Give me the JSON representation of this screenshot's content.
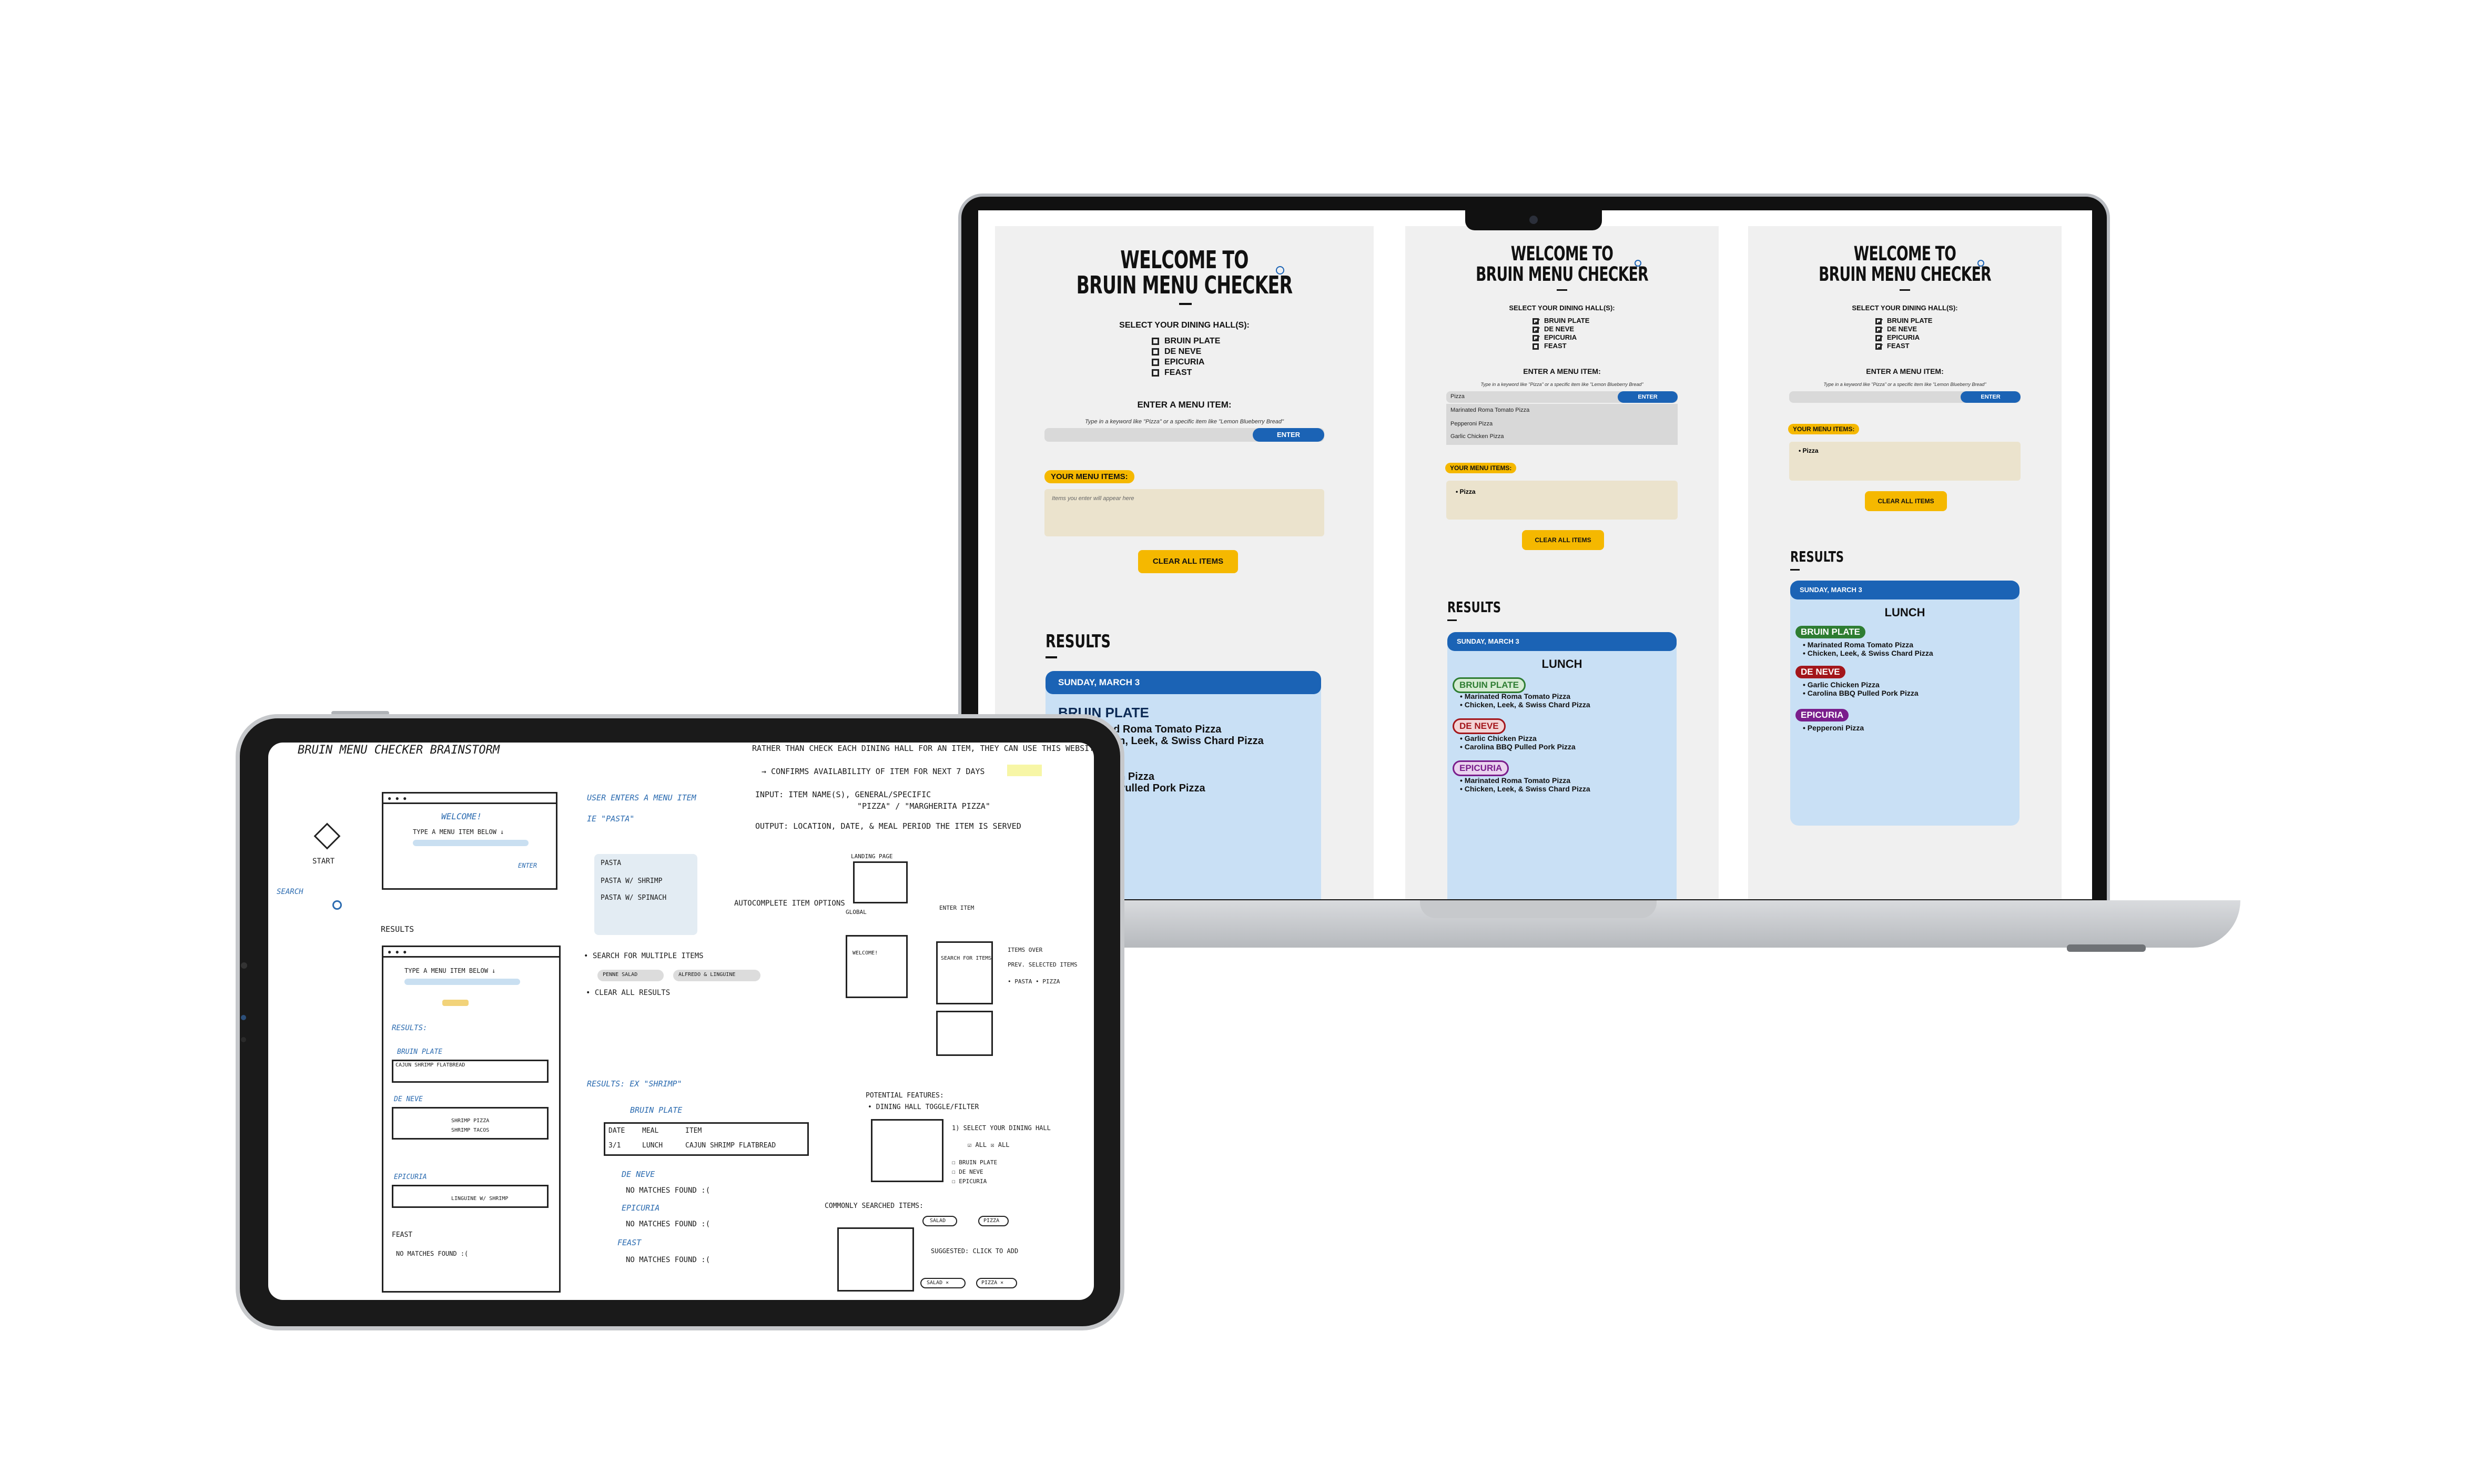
{
  "app": {
    "title_line1": "WELCOME TO",
    "title_line2": "BRUIN MENU CHECKER",
    "info_icon": "info-circle-icon",
    "select_label": "SELECT YOUR DINING HALL(S):",
    "halls": [
      "BRUIN PLATE",
      "DE NEVE",
      "EPICURIA",
      "FEAST"
    ],
    "enter_label": "ENTER A MENU ITEM:",
    "hint": "Type in a keyword like \"Pizza\" or a specific item like \"Lemon Blueberry Bread\"",
    "enter_button": "ENTER",
    "your_items_label": "YOUR MENU ITEMS:",
    "items_placeholder": "Items you enter will appear here",
    "clear_button": "CLEAR ALL ITEMS",
    "results_label": "RESULTS",
    "date": "SUNDAY, MARCH 3",
    "meal": "LUNCH",
    "colors": {
      "accent_blue": "#1b63b5",
      "yellow": "#f5b800",
      "result_bg": "#c9e0f5",
      "bruin_plate": "#2e7d32",
      "de_neve": "#a3161b",
      "epicuria": "#7a1e8c"
    }
  },
  "panel1": {
    "checked": [
      false,
      false,
      false,
      false
    ],
    "results_hall": "BRUIN PLATE",
    "results_items_visible": [
      "…nated Roma Tomato Pizza",
      "…hicken, Leek, & Swiss Chard Pizza",
      "…hicken Pizza",
      "…BBQ Pulled Pork Pizza"
    ]
  },
  "panel2": {
    "checked": [
      true,
      true,
      true,
      false
    ],
    "input_value": "Pizza",
    "dropdown": [
      "Marinated Roma Tomato Pizza",
      "Pepperoni Pizza",
      "Garlic Chicken Pizza"
    ],
    "your_items": [
      "Pizza"
    ],
    "results": [
      {
        "hall": "BRUIN PLATE",
        "items": [
          "Marinated Roma Tomato Pizza",
          "Chicken, Leek, & Swiss Chard Pizza"
        ]
      },
      {
        "hall": "DE NEVE",
        "items": [
          "Garlic Chicken Pizza",
          "Carolina BBQ Pulled Pork Pizza"
        ]
      },
      {
        "hall": "EPICURIA",
        "items": [
          "Marinated Roma Tomato Pizza",
          "Chicken, Leek, & Swiss Chard Pizza"
        ]
      }
    ]
  },
  "panel3": {
    "checked": [
      true,
      true,
      true,
      true
    ],
    "your_items": [
      "Pizza"
    ],
    "results": [
      {
        "hall": "BRUIN PLATE",
        "items": [
          "Marinated Roma Tomato Pizza",
          "Chicken, Leek, & Swiss Chard Pizza"
        ]
      },
      {
        "hall": "DE NEVE",
        "items": [
          "Garlic Chicken Pizza",
          "Carolina BBQ Pulled Pork Pizza"
        ]
      },
      {
        "hall": "EPICURIA",
        "items": [
          "Pepperoni Pizza"
        ]
      }
    ]
  },
  "sketch": {
    "heading": "BRUIN MENU CHECKER BRAINSTORM",
    "intro": "RATHER THAN CHECK EACH DINING HALL FOR AN ITEM, THEY CAN USE THIS WEBSITE TO SEARCH FOR THE ITEM",
    "intro2": "→ CONFIRMS AVAILABILITY OF ITEM FOR NEXT 7 DAYS",
    "input_line": "INPUT: ITEM NAME(S), GENERAL/SPECIFIC",
    "input_ex": "\"PIZZA\" / \"MARGHERITA PIZZA\"",
    "output_line": "OUTPUT: LOCATION, DATE, & MEAL PERIOD THE ITEM IS SERVED",
    "start": "START",
    "search": "SEARCH",
    "welcome": "WELCOME!",
    "type_item": "TYPE A MENU ITEM BELOW ↓",
    "enter": "ENTER",
    "user_enters": "USER ENTERS A MENU ITEM",
    "user_enters2": "IE \"PASTA\"",
    "dd": [
      "PASTA",
      "PASTA W/ SHRIMP",
      "PASTA W/ SPINACH"
    ],
    "autocomplete": "AUTOCOMPLETE ITEM OPTIONS",
    "results": "RESULTS",
    "multi": "• SEARCH FOR MULTIPLE ITEMS",
    "tags": [
      "PENNE SALAD",
      "ALFREDO & LINGUINE"
    ],
    "clear": "• CLEAR ALL RESULTS",
    "r_results": "RESULTS:",
    "bp": "BRUIN PLATE",
    "dn": "DE NEVE",
    "ep": "EPICURIA",
    "feast": "FEAST",
    "nomatch": "NO MATCHES FOUND :(",
    "tbl_head": [
      "DATE",
      "MEAL",
      "ITEM"
    ],
    "row_bp": [
      "3/1",
      "LUNCH",
      "CAJUN SHRIMP FLATBREAD"
    ],
    "row_dn1": [
      "3/1",
      "LUNCH",
      "SHRIMP PIZZA"
    ],
    "row_dn2": [
      "3/1",
      "LUNCH",
      "SHRIMP TACOS"
    ],
    "row_ep": [
      "3/1",
      "LUNCH",
      "LINGUINE W/ SHRIMP"
    ],
    "results_ex": "RESULTS: EX \"SHRIMP\"",
    "landing": "LANDING PAGE",
    "global": "GLOBAL",
    "enter_item": "ENTER ITEM",
    "search_for": "SEARCH FOR ITEMS",
    "items_ova": "ITEMS OVER",
    "prev_sel": "PREV. SELECTED ITEMS",
    "pasta_pizza": "• PASTA  • PIZZA",
    "potential": "POTENTIAL FEATURES:",
    "toggle": "• DINING HALL TOGGLE/FILTER",
    "select_dh": "1) SELECT YOUR DINING HALL",
    "all": "☑ ALL   ☒ ALL",
    "dh_list": [
      "☐ BRUIN PLATE",
      "☐ DE NEVE",
      "☐ EPICURIA"
    ],
    "common": "COMMONLY SEARCHED ITEMS:",
    "common_tags": [
      "SALAD",
      "PIZZA"
    ],
    "suggested": "SUGGESTED: CLICK TO ADD",
    "sugg_tags": [
      "SALAD ×",
      "PIZZA ×"
    ]
  }
}
